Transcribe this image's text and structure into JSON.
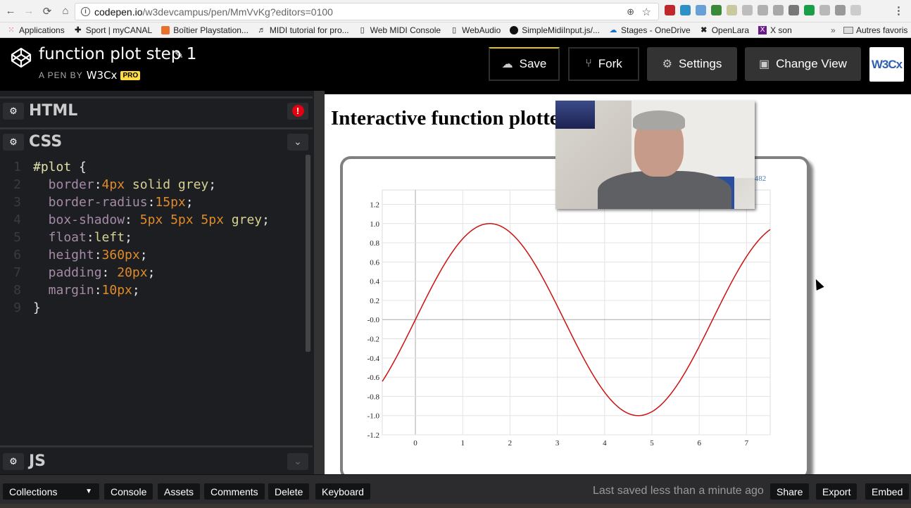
{
  "browser": {
    "url_host": "codepen.io",
    "url_path": "/w3devcampus/pen/MmVvKg?editors=0100",
    "nav": {
      "back": "←",
      "forward": "→",
      "reload": "⟳",
      "home": "⌂"
    },
    "bookmarks": [
      {
        "label": "Applications",
        "icon": "apps-grid-icon"
      },
      {
        "label": "Sport | myCANAL",
        "icon": "plus-icon"
      },
      {
        "label": "Boîtier Playstation...",
        "icon": "box-icon"
      },
      {
        "label": "MIDI tutorial for pro...",
        "icon": "music-icon"
      },
      {
        "label": "Web MIDI Console",
        "icon": "page-icon"
      },
      {
        "label": "WebAudio",
        "icon": "page-icon"
      },
      {
        "label": "SimpleMidiInput.js/...",
        "icon": "github-icon"
      },
      {
        "label": "Stages - OneDrive",
        "icon": "cloud-icon"
      },
      {
        "label": "OpenLara",
        "icon": "openlara-icon"
      },
      {
        "label": "X son",
        "icon": "x-icon"
      }
    ],
    "bookmarks_more": "»",
    "other_bookmarks": "Autres favoris",
    "extension_colors": [
      "#c0272d",
      "#2f8fc7",
      "#6aa0d8",
      "#3b8a3a",
      "#c9c9a0",
      "#bdbdbd",
      "#b0b0b0",
      "#a8a8a8",
      "#777777",
      "#1a9e4a",
      "#b8b8b8",
      "#999999",
      "#cccccc"
    ]
  },
  "header": {
    "pen_title": "function plot step 1",
    "pen_by_label": "A PEN BY",
    "author": "W3Cx",
    "pro_badge": "PRO",
    "buttons": {
      "save": "Save",
      "fork": "Fork",
      "settings": "Settings",
      "change_view": "Change View"
    },
    "logo_text": "W3Cx"
  },
  "editors": {
    "html_label": "HTML",
    "css_label": "CSS",
    "js_label": "JS",
    "error_indicator": "!",
    "css_code": [
      {
        "n": "1",
        "tokens": [
          [
            "sel",
            "#plot "
          ],
          [
            "punc",
            "{"
          ]
        ]
      },
      {
        "n": "2",
        "tokens": [
          [
            "prop",
            "  border"
          ],
          [
            "punc",
            ":"
          ],
          [
            "num",
            "4px"
          ],
          [
            "kw",
            " solid grey"
          ],
          [
            "punc",
            ";"
          ]
        ]
      },
      {
        "n": "3",
        "tokens": [
          [
            "prop",
            "  border-radius"
          ],
          [
            "punc",
            ":"
          ],
          [
            "num",
            "15px"
          ],
          [
            "punc",
            ";"
          ]
        ]
      },
      {
        "n": "4",
        "tokens": [
          [
            "prop",
            "  box-shadow"
          ],
          [
            "punc",
            ": "
          ],
          [
            "num",
            "5px 5px 5px"
          ],
          [
            "kw",
            " grey"
          ],
          [
            "punc",
            ";"
          ]
        ]
      },
      {
        "n": "5",
        "tokens": [
          [
            "prop",
            "  float"
          ],
          [
            "punc",
            ":"
          ],
          [
            "kw",
            "left"
          ],
          [
            "punc",
            ";"
          ]
        ]
      },
      {
        "n": "6",
        "tokens": [
          [
            "prop",
            "  height"
          ],
          [
            "punc",
            ":"
          ],
          [
            "num",
            "360px"
          ],
          [
            "punc",
            ";"
          ]
        ]
      },
      {
        "n": "7",
        "tokens": [
          [
            "prop",
            "  padding"
          ],
          [
            "punc",
            ": "
          ],
          [
            "num",
            "20px"
          ],
          [
            "punc",
            ";"
          ]
        ]
      },
      {
        "n": "8",
        "tokens": [
          [
            "prop",
            "  margin"
          ],
          [
            "punc",
            ":"
          ],
          [
            "num",
            "10px"
          ],
          [
            "punc",
            ";"
          ]
        ]
      },
      {
        "n": "9",
        "tokens": [
          [
            "punc",
            "}"
          ]
        ]
      }
    ]
  },
  "preview": {
    "title": "Interactive function plotter",
    "coord_readout": ".482",
    "curve_color": "#cc1111"
  },
  "chart_data": {
    "type": "line",
    "title": "",
    "function": "sin(x)",
    "xlabel": "",
    "ylabel": "",
    "xlim": [
      -0.7,
      7.5
    ],
    "ylim": [
      -1.2,
      1.35
    ],
    "x_ticks": [
      "0",
      "1",
      "2",
      "3",
      "4",
      "5",
      "6",
      "7"
    ],
    "y_ticks": [
      "1.2",
      "1.0",
      "0.8",
      "0.6",
      "0.4",
      "0.2",
      "-0.0",
      "-0.2",
      "-0.4",
      "-0.6",
      "-0.8",
      "-1.0",
      "-1.2"
    ],
    "grid": true,
    "series": [
      {
        "name": "sin(x)",
        "color": "#cc1111",
        "x_start": -0.7,
        "x_end": 7.5
      }
    ]
  },
  "footer": {
    "collections": "Collections",
    "console": "Console",
    "assets": "Assets",
    "comments": "Comments",
    "delete": "Delete",
    "keyboard": "Keyboard",
    "last_saved": "Last saved less than a minute ago",
    "share": "Share",
    "export": "Export",
    "embed": "Embed"
  }
}
